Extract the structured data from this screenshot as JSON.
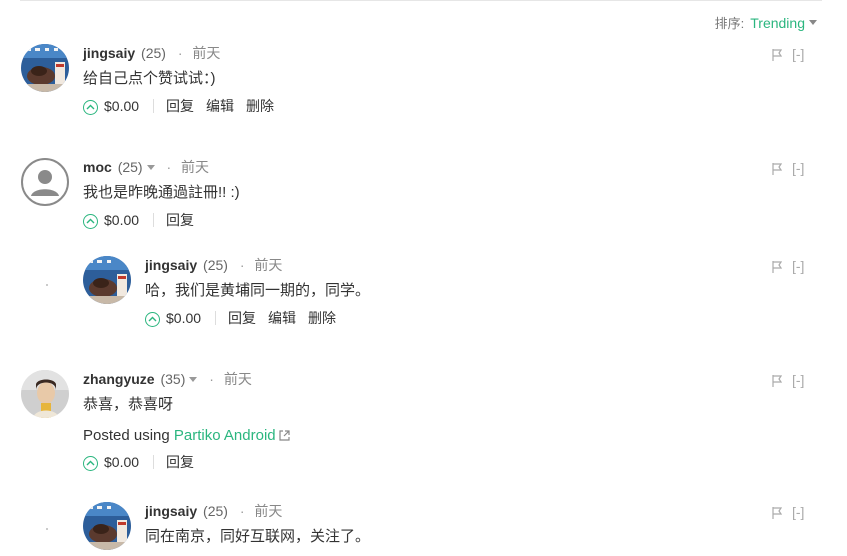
{
  "sort": {
    "label": "排序:",
    "value": "Trending"
  },
  "comments": [
    {
      "author": "jingsaiy",
      "rep": "(25)",
      "time": "前天",
      "text": "给自己点个赞试试：)",
      "payout": "$0.00",
      "actions": [
        "回复",
        "编辑",
        "删除"
      ],
      "collapse": "[-]"
    },
    {
      "author": "moc",
      "rep": "(25)",
      "time": "前天",
      "text": "我也是昨晚通過註冊!! :)",
      "payout": "$0.00",
      "actions": [
        "回复"
      ],
      "collapse": "[-]",
      "replies": [
        {
          "author": "jingsaiy",
          "rep": "(25)",
          "time": "前天",
          "text": "哈，我们是黄埔同一期的，同学。",
          "payout": "$0.00",
          "actions": [
            "回复",
            "编辑",
            "删除"
          ],
          "collapse": "[-]"
        }
      ]
    },
    {
      "author": "zhangyuze",
      "rep": "(35)",
      "time": "前天",
      "text": "恭喜，恭喜呀",
      "posted_prefix": "Posted using",
      "posted_link": "Partiko Android",
      "payout": "$0.00",
      "actions": [
        "回复"
      ],
      "collapse": "[-]",
      "replies": [
        {
          "author": "jingsaiy",
          "rep": "(25)",
          "time": "前天",
          "text": "同在南京，同好互联网，关注了。",
          "collapse": "[-]"
        }
      ]
    }
  ],
  "colors": {
    "accent": "#2bb67f",
    "muted": "#888888"
  },
  "icons": [
    "flag-icon",
    "upvote-icon",
    "external-link-icon",
    "chevron-down-icon",
    "user-placeholder-icon"
  ]
}
